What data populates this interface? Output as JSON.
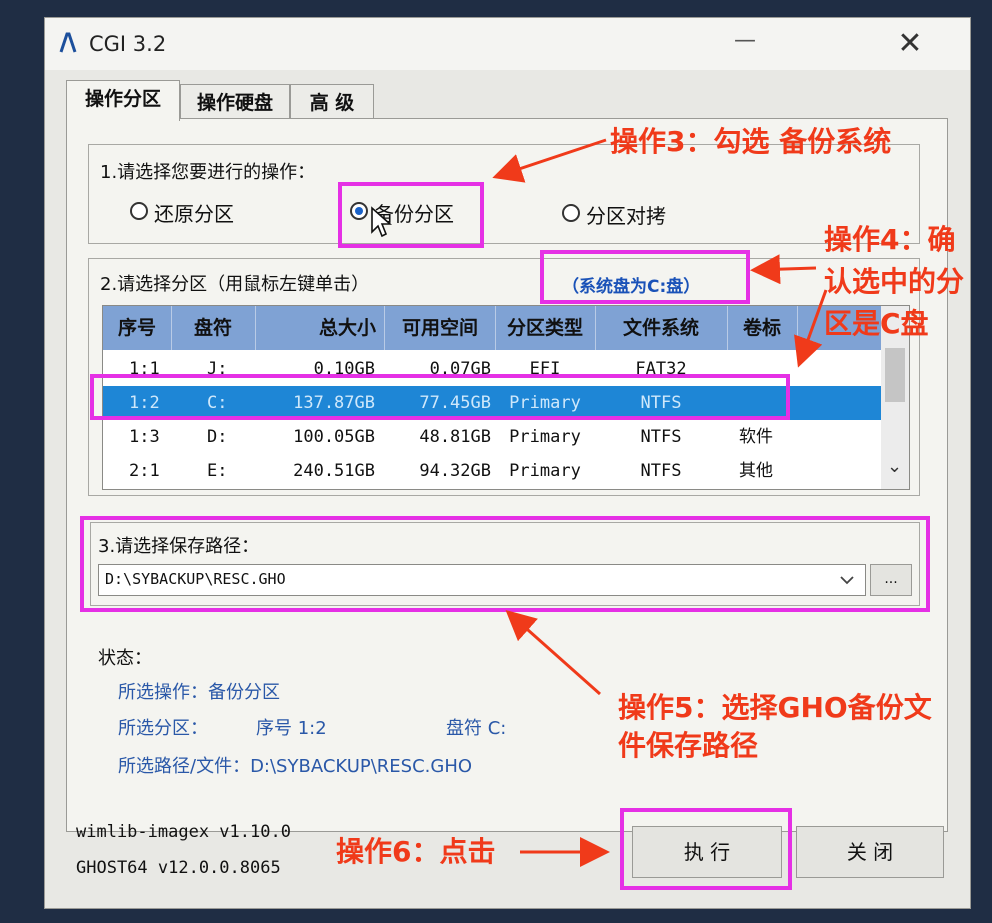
{
  "window": {
    "title": "CGI 3.2",
    "minimize": "—",
    "close": "✕"
  },
  "tabs": [
    "操作分区",
    "操作硬盘",
    "高 级"
  ],
  "step1": {
    "label": "1.请选择您要进行的操作：",
    "options": [
      {
        "label": "还原分区",
        "selected": false
      },
      {
        "label": "备份分区",
        "selected": true
      },
      {
        "label": "分区对拷",
        "selected": false
      }
    ]
  },
  "step2": {
    "label": "2.请选择分区（用鼠标左键单击）",
    "system_disk_note": "（系统盘为C:盘）",
    "columns": [
      "序号",
      "盘符",
      "总大小",
      "可用空间",
      "分区类型",
      "文件系统",
      "卷标"
    ],
    "rows": [
      [
        "1:1",
        "J:",
        "0.10GB",
        "0.07GB",
        "EFI",
        "FAT32",
        ""
      ],
      [
        "1:2",
        "C:",
        "137.87GB",
        "77.45GB",
        "Primary",
        "NTFS",
        ""
      ],
      [
        "1:3",
        "D:",
        "100.05GB",
        "48.81GB",
        "Primary",
        "NTFS",
        "软件"
      ],
      [
        "2:1",
        "E:",
        "240.51GB",
        "94.32GB",
        "Primary",
        "NTFS",
        "其他"
      ]
    ],
    "selected_row": 1,
    "scroll_up": "^",
    "scroll_down": "⌄"
  },
  "step3": {
    "label": "3.请选择保存路径：",
    "path_value": "D:\\SYBACKUP\\RESC.GHO",
    "browse_label": "..."
  },
  "status": {
    "label": "状态：",
    "operation": "所选操作：备份分区",
    "partition_prefix": "所选分区：",
    "partition_seq": "序号 1:2",
    "partition_letter": "盘符 C:",
    "path": "所选路径/文件：D:\\SYBACKUP\\RESC.GHO"
  },
  "footer": {
    "version1": "wimlib-imagex v1.10.0",
    "version2": "GHOST64 v12.0.0.8065",
    "execute_label": "执 行",
    "close_label": "关 闭"
  },
  "annotations": {
    "op3": "操作3：勾选 备份系统",
    "op4_lines": [
      "操作4：确",
      "认选中的分",
      "区是C盘"
    ],
    "op5_lines": [
      "操作5：选择GHO备份文",
      "件保存路径"
    ],
    "op6": "操作6：点击",
    "highlight_color": "#e530e5",
    "note_color": "#f03a1a"
  }
}
